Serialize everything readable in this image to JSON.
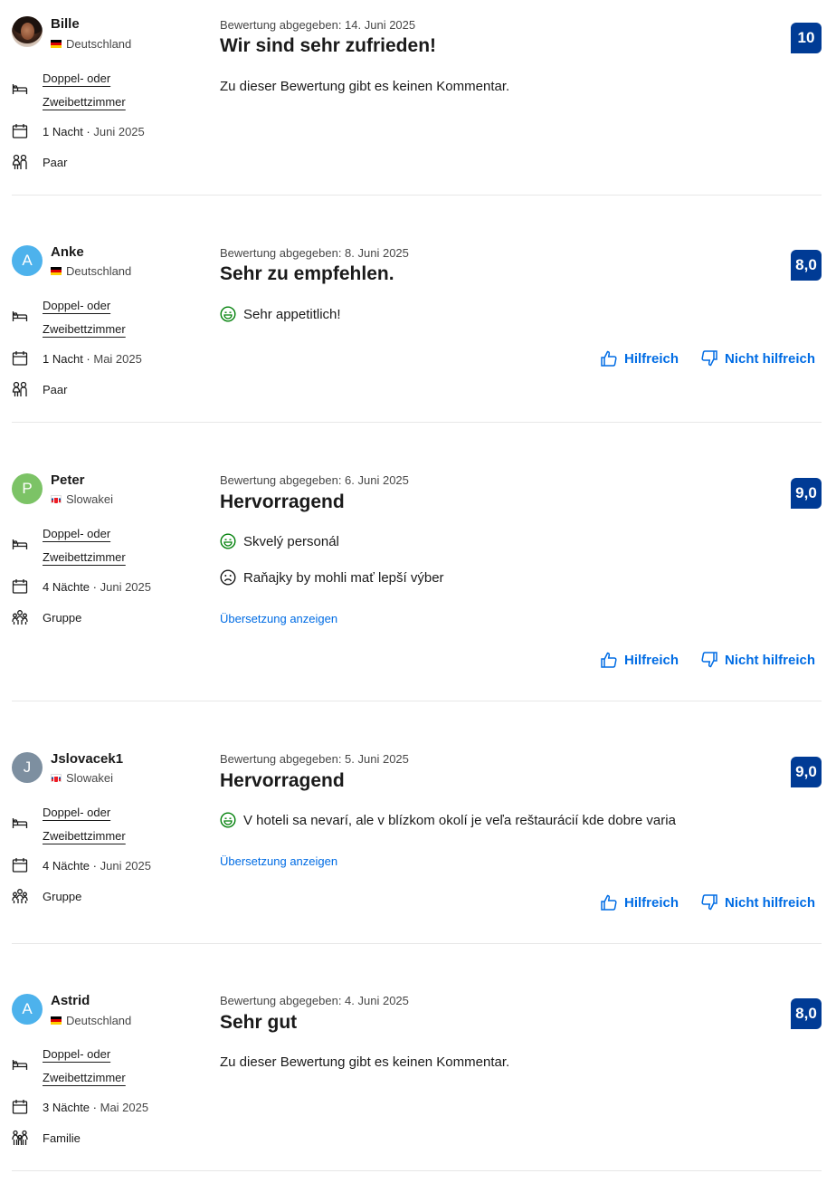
{
  "labels": {
    "submitted_prefix": "Bewertung abgegeben:",
    "helpful": "Hilfreich",
    "not_helpful": "Nicht hilfreich",
    "show_translation": "Übersetzung anzeigen",
    "no_comment": "Zu dieser Bewertung gibt es keinen Kommentar."
  },
  "colors": {
    "score_bg": "#003b95",
    "link": "#006ce4",
    "positive": "#008009",
    "negative": "#1a1a1a"
  },
  "reviews": [
    {
      "name": "Bille",
      "avatar": "photo",
      "avatar_letter": "",
      "avatar_color": "",
      "country": "Deutschland",
      "flag": "de",
      "room_line1": "Doppel- oder",
      "room_line2": "Zweibettzimmer",
      "nights": "1 Nacht",
      "month": "Juni 2025",
      "traveler": "Paar",
      "traveler_icon": "couple-icon",
      "date": "Bewertung abgegeben: 14. Juni 2025",
      "title": "Wir sind sehr zufrieden!",
      "score": "10",
      "comment": "Zu dieser Bewertung gibt es keinen Kommentar."
    },
    {
      "name": "Anke",
      "avatar": "letter",
      "avatar_letter": "A",
      "avatar_color": "#4db2ec",
      "country": "Deutschland",
      "flag": "de",
      "room_line1": "Doppel- oder",
      "room_line2": "Zweibettzimmer",
      "nights": "1 Nacht",
      "month": "Mai 2025",
      "traveler": "Paar",
      "traveler_icon": "couple-icon",
      "date": "Bewertung abgegeben: 8. Juni 2025",
      "title": "Sehr zu empfehlen.",
      "score": "8,0",
      "positive": "Sehr appetitlich!"
    },
    {
      "name": "Peter",
      "avatar": "letter",
      "avatar_letter": "P",
      "avatar_color": "#7cc366",
      "country": "Slowakei",
      "flag": "sk",
      "room_line1": "Doppel- oder",
      "room_line2": "Zweibettzimmer",
      "nights": "4 Nächte",
      "month": "Juni 2025",
      "traveler": "Gruppe",
      "traveler_icon": "group-icon",
      "date": "Bewertung abgegeben: 6. Juni 2025",
      "title": "Hervorragend",
      "score": "9,0",
      "positive": "Skvelý personál",
      "negative": "Raňajky by mohli mať lepší výber"
    },
    {
      "name": "Jslovacek1",
      "avatar": "letter",
      "avatar_letter": "J",
      "avatar_color": "#7d8fa0",
      "country": "Slowakei",
      "flag": "sk",
      "room_line1": "Doppel- oder",
      "room_line2": "Zweibettzimmer",
      "nights": "4 Nächte",
      "month": "Juni 2025",
      "traveler": "Gruppe",
      "traveler_icon": "group-icon",
      "date": "Bewertung abgegeben: 5. Juni 2025",
      "title": "Hervorragend",
      "score": "9,0",
      "positive": "V hoteli sa nevarí, ale v blízkom okolí je veľa reštaurácií kde dobre varia"
    },
    {
      "name": "Astrid",
      "avatar": "letter",
      "avatar_letter": "A",
      "avatar_color": "#4db2ec",
      "country": "Deutschland",
      "flag": "de",
      "room_line1": "Doppel- oder",
      "room_line2": "Zweibettzimmer",
      "nights": "3 Nächte",
      "month": "Mai 2025",
      "traveler": "Familie",
      "traveler_icon": "family-icon",
      "date": "Bewertung abgegeben: 4. Juni 2025",
      "title": "Sehr gut",
      "score": "8,0",
      "comment": "Zu dieser Bewertung gibt es keinen Kommentar."
    }
  ]
}
